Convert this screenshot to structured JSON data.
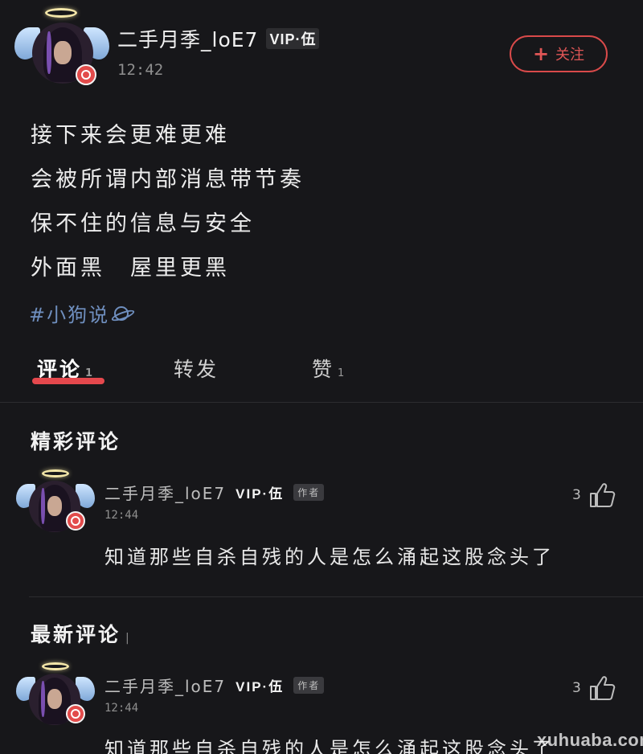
{
  "post": {
    "username": "二手月季_loE7",
    "vip_label": "VIP·伍",
    "time": "12:42",
    "follow_label": "关注",
    "lines": [
      "接下来会更难更难",
      "会被所谓内部消息带节奏",
      "保不住的信息与安全",
      "外面黑　屋里更黑"
    ],
    "hashtag": "#小狗说"
  },
  "tabs": [
    {
      "label": "评论",
      "count": "1",
      "active": true
    },
    {
      "label": "转发",
      "count": "",
      "active": false
    },
    {
      "label": "赞",
      "count": "1",
      "active": false
    }
  ],
  "sections": {
    "featured_title": "精彩评论",
    "latest_title": "最新评论",
    "latest_cursor": "|"
  },
  "comments": [
    {
      "username": "二手月季_loE7",
      "vip_label": "VIP·伍",
      "author_tag": "作者",
      "time": "12:44",
      "likes": "3",
      "text": "知道那些自杀自残的人是怎么涌起这股念头了"
    },
    {
      "username": "二手月季_loE7",
      "vip_label": "VIP·伍",
      "author_tag": "作者",
      "time": "12:44",
      "likes": "3",
      "text": "知道那些自杀自残的人是怎么涌起这股念头了"
    }
  ],
  "watermark": "xuhuaba.com",
  "colors": {
    "background": "#17171a",
    "accent_red": "#e5484d",
    "hashtag_blue": "#6f8fbf"
  }
}
